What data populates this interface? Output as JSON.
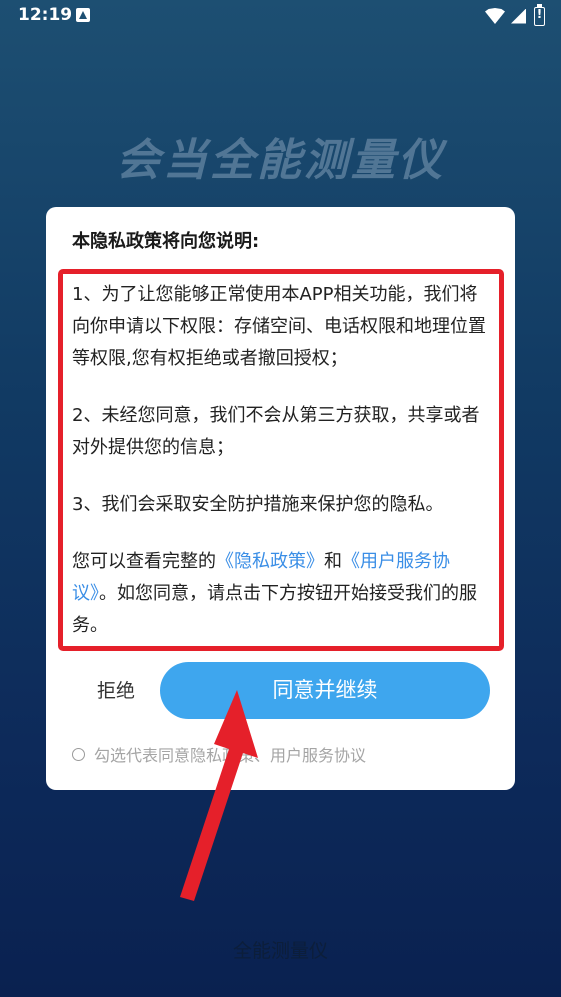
{
  "status_bar": {
    "time": "12:19",
    "icons": [
      "notification-icon",
      "wifi-icon",
      "signal-icon",
      "battery-alert-icon"
    ]
  },
  "background_title": "会当全能测量仪",
  "dialog": {
    "title": "本隐私政策将向您说明:",
    "paragraphs": {
      "p1": "1、为了让您能够正常使用本APP相关功能，我们将向你申请以下权限：存储空间、电话权限和地理位置等权限,您有权拒绝或者撤回授权；",
      "p2": "2、未经您同意，我们不会从第三方获取，共享或者对外提供您的信息；",
      "p3": "3、我们会采取安全防护措施来保护您的隐私。",
      "p4_prefix": "您可以查看完整的",
      "p4_link1": "《隐私政策》",
      "p4_and": "和",
      "p4_link2": "《用户服务协议》",
      "p4_suffix": "。如您同意，请点击下方按钮开始接受我们的服务。"
    },
    "reject_label": "拒绝",
    "agree_label": "同意并继续",
    "consent_label": "勾选代表同意隐私政策、用户服务协议"
  },
  "footer_text": "全能测量仪",
  "colors": {
    "primary_button": "#3ea6ee",
    "link": "#3a8ee6",
    "annotation_red": "#e5202a"
  }
}
